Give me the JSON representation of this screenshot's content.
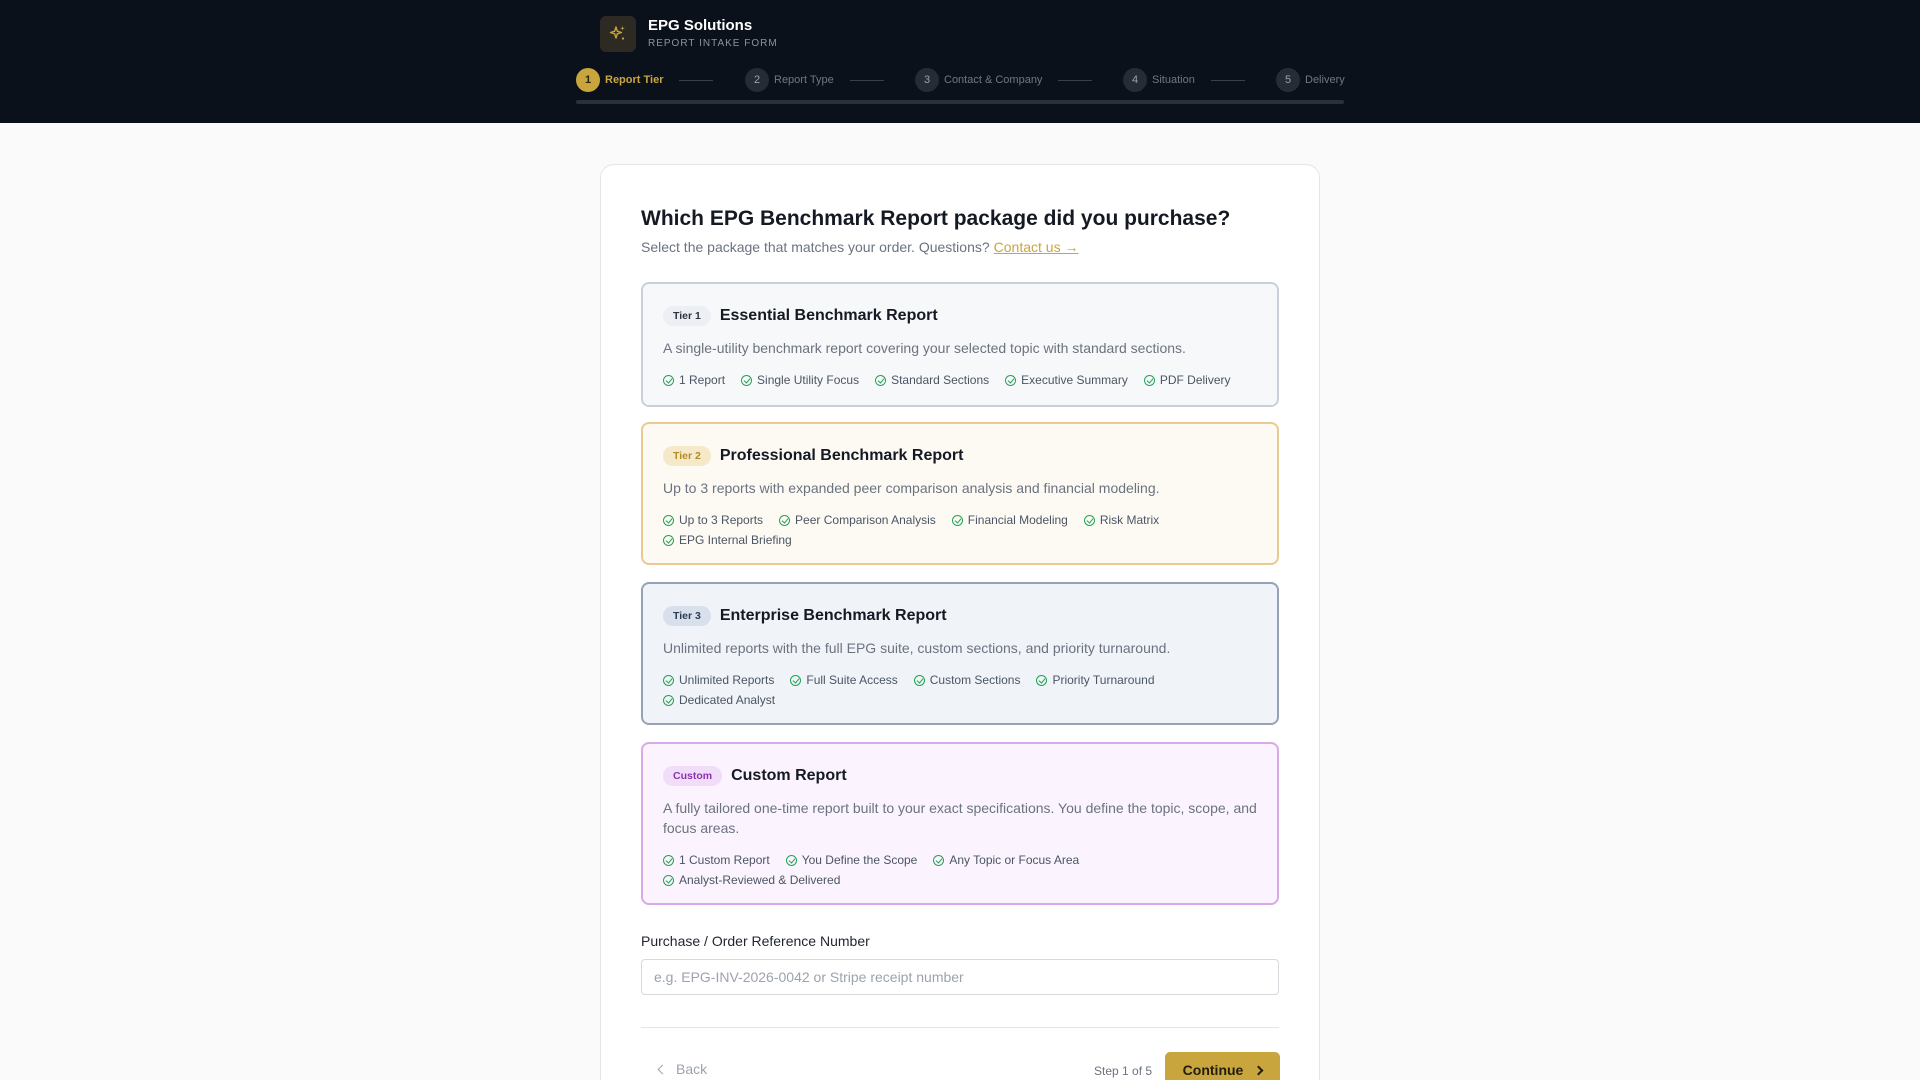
{
  "brand": {
    "name": "EPG Solutions",
    "subtitle": "REPORT INTAKE FORM",
    "logo_icon": "sparkle-icon",
    "accent": "#c9a53e"
  },
  "steps": [
    {
      "num": "1",
      "label": "Report Tier",
      "state": "active"
    },
    {
      "num": "2",
      "label": "Report Type",
      "state": "upcoming"
    },
    {
      "num": "3",
      "label": "Contact & Company",
      "state": "upcoming"
    },
    {
      "num": "4",
      "label": "Situation",
      "state": "upcoming"
    },
    {
      "num": "5",
      "label": "Delivery",
      "state": "upcoming"
    }
  ],
  "progress": {
    "fraction": 0.0
  },
  "question": {
    "title": "Which EPG Benchmark Report package did you purchase?",
    "subtitle": "Select the package that matches your order. Questions?",
    "contact_link": "Contact us →"
  },
  "tiers": [
    {
      "badge": "Tier 1",
      "name": "Essential Benchmark Report",
      "description": "A single-utility benchmark report covering your selected topic with standard sections.",
      "features": [
        "1 Report",
        "Single Utility Focus",
        "Standard Sections",
        "Executive Summary",
        "PDF Delivery"
      ]
    },
    {
      "badge": "Tier 2",
      "name": "Professional Benchmark Report",
      "description": "Up to 3 reports with expanded peer comparison analysis and financial modeling.",
      "features": [
        "Up to 3 Reports",
        "Peer Comparison Analysis",
        "Financial Modeling",
        "Risk Matrix",
        "EPG Internal Briefing"
      ]
    },
    {
      "badge": "Tier 3",
      "name": "Enterprise Benchmark Report",
      "description": "Unlimited reports with the full EPG suite, custom sections, and priority turnaround.",
      "features": [
        "Unlimited Reports",
        "Full Suite Access",
        "Custom Sections",
        "Priority Turnaround",
        "Dedicated Analyst"
      ]
    },
    {
      "badge": "Custom",
      "name": "Custom Report",
      "description": "A fully tailored one-time report built to your exact specifications. You define the topic, scope, and focus areas.",
      "features": [
        "1 Custom Report",
        "You Define the Scope",
        "Any Topic or Focus Area",
        "Analyst-Reviewed & Delivered"
      ]
    }
  ],
  "reference": {
    "label": "Purchase / Order Reference Number",
    "placeholder": "e.g. EPG-INV-2026-0042 or Stripe receipt number",
    "value": ""
  },
  "footer": {
    "back_label": "Back",
    "step_count": "Step 1 of 5",
    "continue_label": "Continue"
  }
}
